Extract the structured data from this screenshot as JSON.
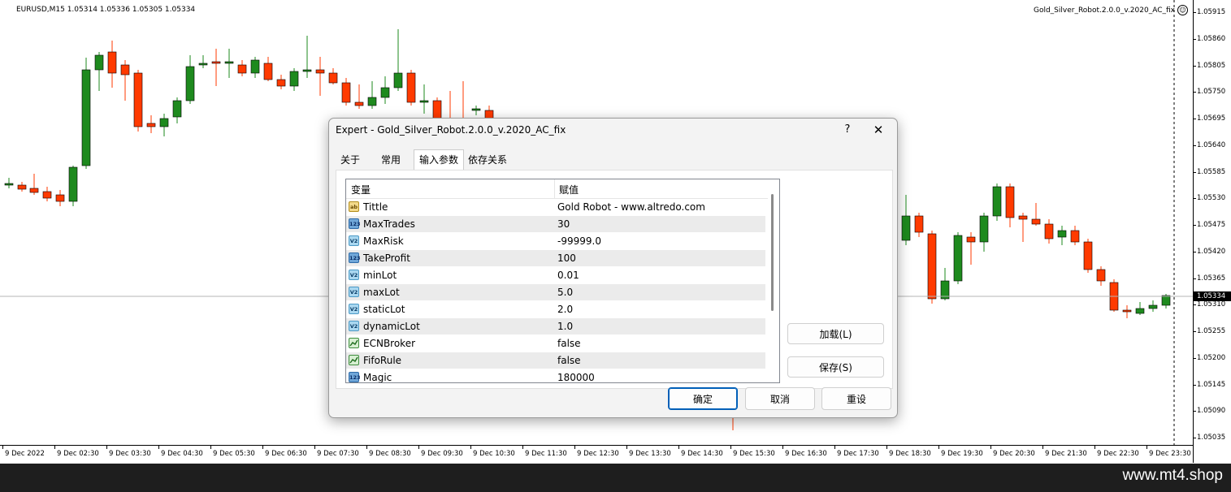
{
  "chart": {
    "header": "EURUSD,M15  1.05314 1.05336 1.05305 1.05334",
    "ea_label": "Gold_Silver_Robot.2.0.0_v.2020_AC_fix",
    "ea_face": "☺",
    "price_labels": [
      "1.05915",
      "1.05860",
      "1.05805",
      "1.05750",
      "1.05695",
      "1.05640",
      "1.05585",
      "1.05530",
      "1.05475",
      "1.05420",
      "1.05365",
      "1.05310",
      "1.05255",
      "1.05200",
      "1.05145",
      "1.05090",
      "1.05035"
    ],
    "current_price": "1.05334",
    "time_labels": [
      "9 Dec 2022",
      "9 Dec 02:30",
      "9 Dec 03:30",
      "9 Dec 04:30",
      "9 Dec 05:30",
      "9 Dec 06:30",
      "9 Dec 07:30",
      "9 Dec 08:30",
      "9 Dec 09:30",
      "9 Dec 10:30",
      "9 Dec 11:30",
      "9 Dec 12:30",
      "9 Dec 13:30",
      "9 Dec 14:30",
      "9 Dec 15:30",
      "9 Dec 16:30",
      "9 Dec 17:30",
      "9 Dec 18:30",
      "9 Dec 19:30",
      "9 Dec 20:30",
      "9 Dec 21:30",
      "9 Dec 22:30",
      "9 Dec 23:30"
    ],
    "colors": {
      "bull": "#1e8a1e",
      "bear": "#ff3a00",
      "wick": "#000000"
    }
  },
  "dialog": {
    "title": "Expert - Gold_Silver_Robot.2.0.0_v.2020_AC_fix",
    "help": "?",
    "close": "✕",
    "tabs": [
      {
        "label": "关于"
      },
      {
        "label": "常用"
      },
      {
        "label": "输入参数"
      },
      {
        "label": "依存关系"
      }
    ],
    "active_tab": "输入参数",
    "grid": {
      "col_variable": "变量",
      "col_value": "赋值",
      "rows": [
        {
          "icon": "string-type-icon",
          "badge": "ab",
          "name": "Tittle",
          "value": "Gold Robot - www.altredo.com"
        },
        {
          "icon": "integer-type-icon",
          "badge": "123",
          "name": "MaxTrades",
          "value": "30"
        },
        {
          "icon": "double-type-icon",
          "badge": "V2",
          "name": "MaxRisk",
          "value": "-99999.0"
        },
        {
          "icon": "integer-type-icon",
          "badge": "123",
          "name": "TakeProfit",
          "value": "100"
        },
        {
          "icon": "double-type-icon",
          "badge": "V2",
          "name": "minLot",
          "value": "0.01"
        },
        {
          "icon": "double-type-icon",
          "badge": "V2",
          "name": "maxLot",
          "value": "5.0"
        },
        {
          "icon": "double-type-icon",
          "badge": "V2",
          "name": "staticLot",
          "value": "2.0"
        },
        {
          "icon": "double-type-icon",
          "badge": "V2",
          "name": "dynamicLot",
          "value": "1.0"
        },
        {
          "icon": "bool-type-icon",
          "badge": "",
          "name": "ECNBroker",
          "value": "false"
        },
        {
          "icon": "bool-type-icon",
          "badge": "",
          "name": "FifoRule",
          "value": "false"
        },
        {
          "icon": "integer-type-icon",
          "badge": "123",
          "name": "Magic",
          "value": "180000"
        }
      ]
    },
    "load_button": "加载(L)",
    "save_button": "保存(S)",
    "ok_button": "确定",
    "cancel_button": "取消",
    "reset_button": "重设"
  },
  "footer": {
    "watermark": "www.mt4.shop"
  }
}
